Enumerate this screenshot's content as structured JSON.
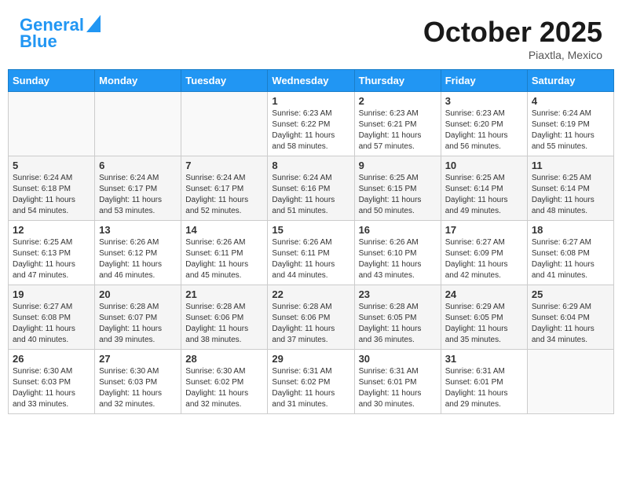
{
  "header": {
    "logo_line1": "General",
    "logo_line2": "Blue",
    "month": "October 2025",
    "location": "Piaxtla, Mexico"
  },
  "days_of_week": [
    "Sunday",
    "Monday",
    "Tuesday",
    "Wednesday",
    "Thursday",
    "Friday",
    "Saturday"
  ],
  "weeks": [
    [
      {
        "day": "",
        "info": ""
      },
      {
        "day": "",
        "info": ""
      },
      {
        "day": "",
        "info": ""
      },
      {
        "day": "1",
        "info": "Sunrise: 6:23 AM\nSunset: 6:22 PM\nDaylight: 11 hours and 58 minutes."
      },
      {
        "day": "2",
        "info": "Sunrise: 6:23 AM\nSunset: 6:21 PM\nDaylight: 11 hours and 57 minutes."
      },
      {
        "day": "3",
        "info": "Sunrise: 6:23 AM\nSunset: 6:20 PM\nDaylight: 11 hours and 56 minutes."
      },
      {
        "day": "4",
        "info": "Sunrise: 6:24 AM\nSunset: 6:19 PM\nDaylight: 11 hours and 55 minutes."
      }
    ],
    [
      {
        "day": "5",
        "info": "Sunrise: 6:24 AM\nSunset: 6:18 PM\nDaylight: 11 hours and 54 minutes."
      },
      {
        "day": "6",
        "info": "Sunrise: 6:24 AM\nSunset: 6:17 PM\nDaylight: 11 hours and 53 minutes."
      },
      {
        "day": "7",
        "info": "Sunrise: 6:24 AM\nSunset: 6:17 PM\nDaylight: 11 hours and 52 minutes."
      },
      {
        "day": "8",
        "info": "Sunrise: 6:24 AM\nSunset: 6:16 PM\nDaylight: 11 hours and 51 minutes."
      },
      {
        "day": "9",
        "info": "Sunrise: 6:25 AM\nSunset: 6:15 PM\nDaylight: 11 hours and 50 minutes."
      },
      {
        "day": "10",
        "info": "Sunrise: 6:25 AM\nSunset: 6:14 PM\nDaylight: 11 hours and 49 minutes."
      },
      {
        "day": "11",
        "info": "Sunrise: 6:25 AM\nSunset: 6:14 PM\nDaylight: 11 hours and 48 minutes."
      }
    ],
    [
      {
        "day": "12",
        "info": "Sunrise: 6:25 AM\nSunset: 6:13 PM\nDaylight: 11 hours and 47 minutes."
      },
      {
        "day": "13",
        "info": "Sunrise: 6:26 AM\nSunset: 6:12 PM\nDaylight: 11 hours and 46 minutes."
      },
      {
        "day": "14",
        "info": "Sunrise: 6:26 AM\nSunset: 6:11 PM\nDaylight: 11 hours and 45 minutes."
      },
      {
        "day": "15",
        "info": "Sunrise: 6:26 AM\nSunset: 6:11 PM\nDaylight: 11 hours and 44 minutes."
      },
      {
        "day": "16",
        "info": "Sunrise: 6:26 AM\nSunset: 6:10 PM\nDaylight: 11 hours and 43 minutes."
      },
      {
        "day": "17",
        "info": "Sunrise: 6:27 AM\nSunset: 6:09 PM\nDaylight: 11 hours and 42 minutes."
      },
      {
        "day": "18",
        "info": "Sunrise: 6:27 AM\nSunset: 6:08 PM\nDaylight: 11 hours and 41 minutes."
      }
    ],
    [
      {
        "day": "19",
        "info": "Sunrise: 6:27 AM\nSunset: 6:08 PM\nDaylight: 11 hours and 40 minutes."
      },
      {
        "day": "20",
        "info": "Sunrise: 6:28 AM\nSunset: 6:07 PM\nDaylight: 11 hours and 39 minutes."
      },
      {
        "day": "21",
        "info": "Sunrise: 6:28 AM\nSunset: 6:06 PM\nDaylight: 11 hours and 38 minutes."
      },
      {
        "day": "22",
        "info": "Sunrise: 6:28 AM\nSunset: 6:06 PM\nDaylight: 11 hours and 37 minutes."
      },
      {
        "day": "23",
        "info": "Sunrise: 6:28 AM\nSunset: 6:05 PM\nDaylight: 11 hours and 36 minutes."
      },
      {
        "day": "24",
        "info": "Sunrise: 6:29 AM\nSunset: 6:05 PM\nDaylight: 11 hours and 35 minutes."
      },
      {
        "day": "25",
        "info": "Sunrise: 6:29 AM\nSunset: 6:04 PM\nDaylight: 11 hours and 34 minutes."
      }
    ],
    [
      {
        "day": "26",
        "info": "Sunrise: 6:30 AM\nSunset: 6:03 PM\nDaylight: 11 hours and 33 minutes."
      },
      {
        "day": "27",
        "info": "Sunrise: 6:30 AM\nSunset: 6:03 PM\nDaylight: 11 hours and 32 minutes."
      },
      {
        "day": "28",
        "info": "Sunrise: 6:30 AM\nSunset: 6:02 PM\nDaylight: 11 hours and 32 minutes."
      },
      {
        "day": "29",
        "info": "Sunrise: 6:31 AM\nSunset: 6:02 PM\nDaylight: 11 hours and 31 minutes."
      },
      {
        "day": "30",
        "info": "Sunrise: 6:31 AM\nSunset: 6:01 PM\nDaylight: 11 hours and 30 minutes."
      },
      {
        "day": "31",
        "info": "Sunrise: 6:31 AM\nSunset: 6:01 PM\nDaylight: 11 hours and 29 minutes."
      },
      {
        "day": "",
        "info": ""
      }
    ]
  ]
}
